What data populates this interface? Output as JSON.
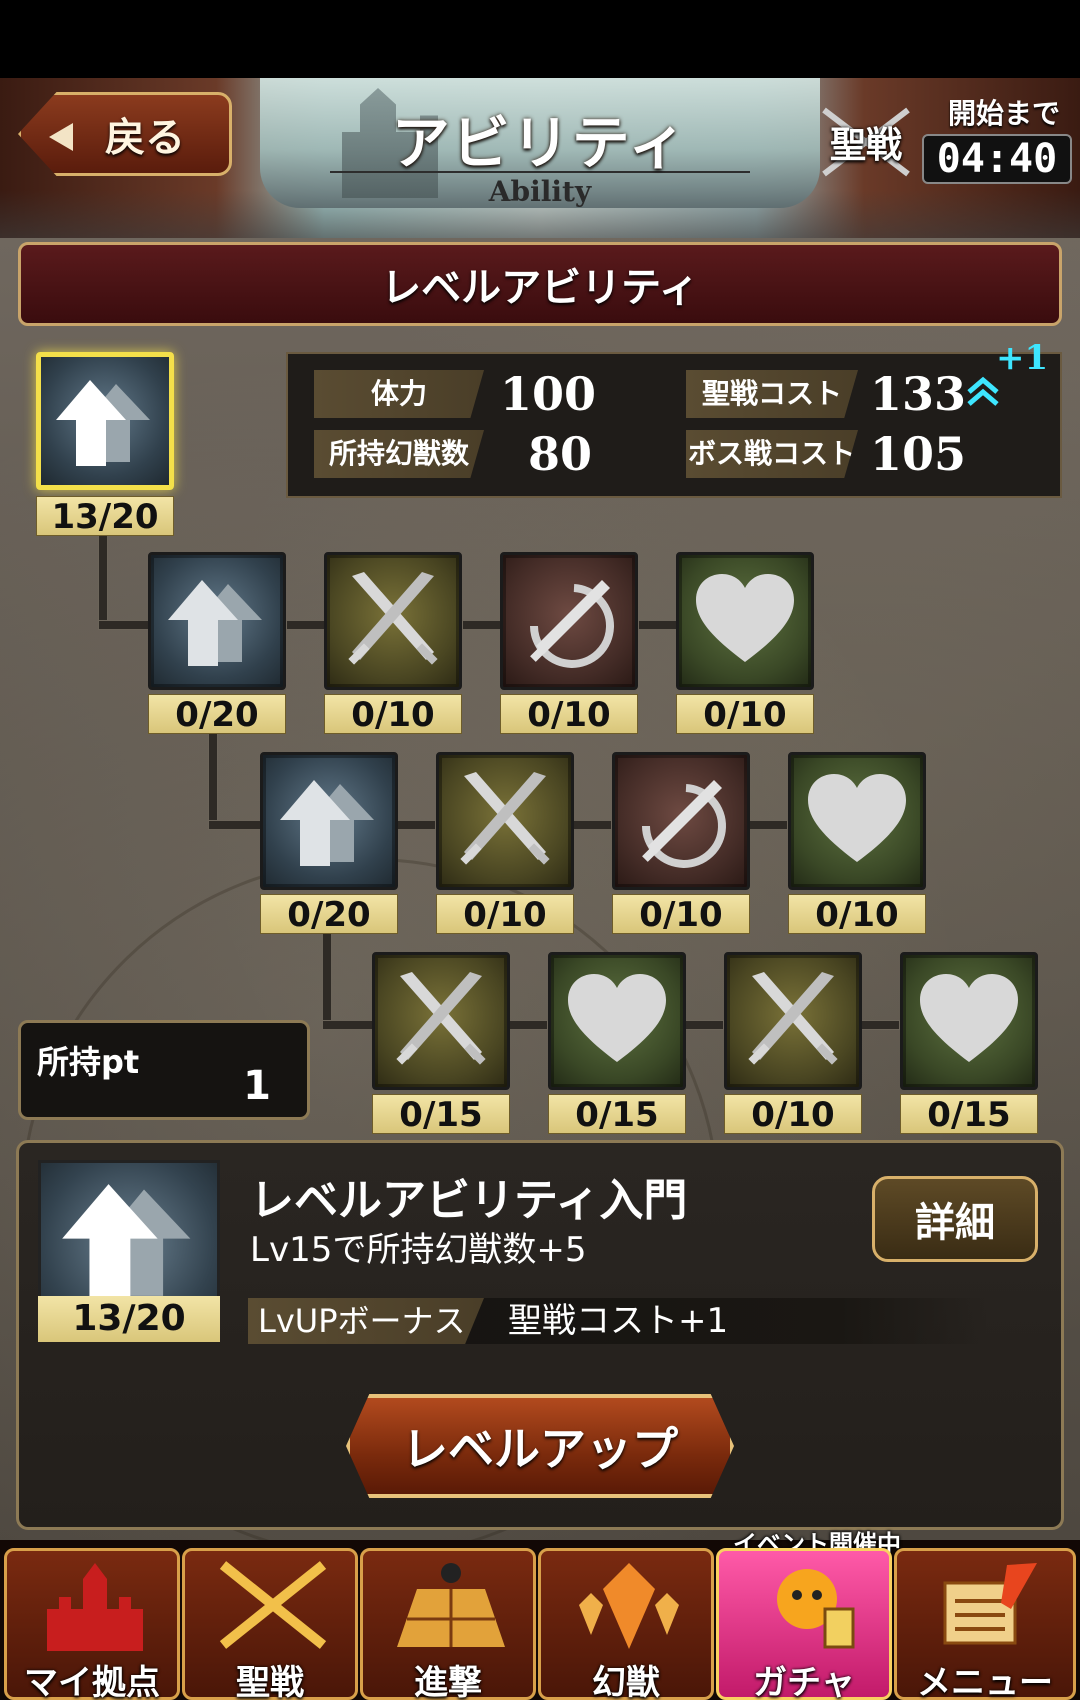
{
  "header": {
    "back_label": "戻る",
    "title": "アビリティ",
    "subtitle": "Ability",
    "event_badge": "聖戦",
    "until_start_label": "開始まで",
    "countdown": "04:40"
  },
  "section": {
    "title": "レベルアビリティ"
  },
  "stats": {
    "stamina_label": "体力",
    "stamina_value": "100",
    "holy_war_cost_label": "聖戦コスト",
    "holy_war_cost_value": "133",
    "holy_war_cost_change": "+1",
    "owned_beasts_label": "所持幻獣数",
    "owned_beasts_value": "80",
    "boss_cost_label": "ボス戦コスト",
    "boss_cost_value": "105"
  },
  "tree": {
    "root": {
      "icon": "double-arrow-up-icon",
      "color": "blue",
      "count": "13/20"
    },
    "row1": [
      {
        "icon": "double-arrow-up-icon",
        "color": "blue",
        "count": "0/20"
      },
      {
        "icon": "crossed-swords-icon",
        "color": "olive",
        "count": "0/10"
      },
      {
        "icon": "sword-slash-icon",
        "color": "maroon",
        "count": "0/10"
      },
      {
        "icon": "heart-icon",
        "color": "green",
        "count": "0/10"
      }
    ],
    "row2": [
      {
        "icon": "double-arrow-up-icon",
        "color": "blue",
        "count": "0/20"
      },
      {
        "icon": "crossed-swords-icon",
        "color": "olive",
        "count": "0/10"
      },
      {
        "icon": "sword-slash-icon",
        "color": "maroon",
        "count": "0/10"
      },
      {
        "icon": "heart-icon",
        "color": "green",
        "count": "0/10"
      }
    ],
    "row3": [
      {
        "icon": "crossed-swords-icon",
        "color": "olive",
        "count": "0/15"
      },
      {
        "icon": "heart-icon",
        "color": "green",
        "count": "0/15"
      },
      {
        "icon": "crossed-swords-icon",
        "color": "olive",
        "count": "0/10"
      },
      {
        "icon": "heart-icon",
        "color": "green",
        "count": "0/15"
      }
    ]
  },
  "owned_points": {
    "label": "所持pt",
    "value": "1"
  },
  "detail": {
    "count": "13/20",
    "name": "レベルアビリティ入門",
    "description": "Lv15で所持幻獣数+5",
    "detail_button": "詳細",
    "bonus_label": "LvUPボーナス",
    "bonus_value": "聖戦コスト+1",
    "levelup_button": "レベルアップ"
  },
  "nav": {
    "event_banner": "イベント開催中",
    "items": [
      {
        "label": "マイ拠点",
        "icon": "castle-icon"
      },
      {
        "label": "聖戦",
        "icon": "crossed-swords-icon"
      },
      {
        "label": "進撃",
        "icon": "battle-map-icon"
      },
      {
        "label": "幻獣",
        "icon": "crystal-icon"
      },
      {
        "label": "ガチャ",
        "icon": "gacha-mascot-icon"
      },
      {
        "label": "メニュー",
        "icon": "scroll-quill-icon"
      }
    ]
  }
}
